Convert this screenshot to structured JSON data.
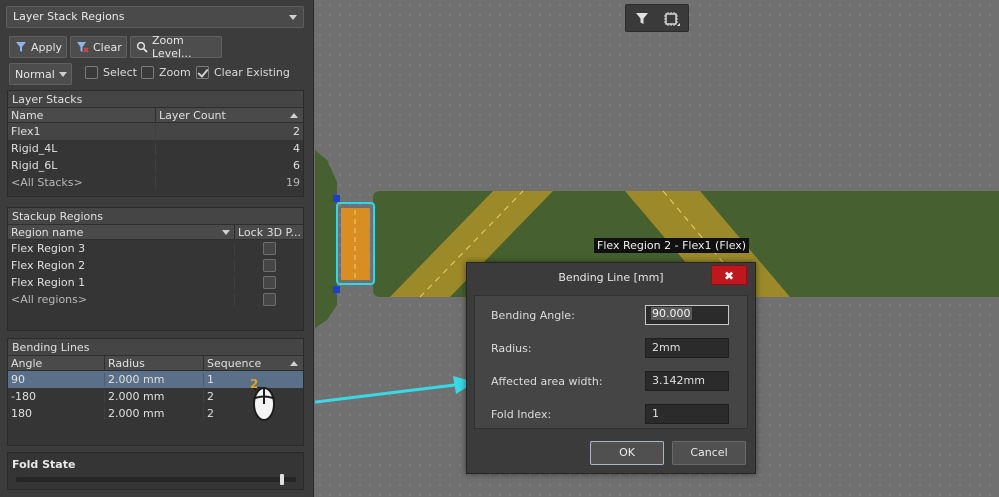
{
  "panel": {
    "mode_dropdown": "Layer Stack Regions",
    "buttons": {
      "apply": "Apply",
      "clear": "Clear",
      "zoom": "Zoom Level..."
    },
    "filter_mode": "Normal",
    "checks": [
      {
        "label": "Select",
        "checked": false
      },
      {
        "label": "Zoom",
        "checked": false
      },
      {
        "label": "Clear Existing",
        "checked": true
      }
    ]
  },
  "layer_stacks": {
    "title": "Layer Stacks",
    "columns": [
      "Name",
      "Layer Count"
    ],
    "rows": [
      {
        "name": "Flex1",
        "count": "2"
      },
      {
        "name": "Rigid_4L",
        "count": "4"
      },
      {
        "name": "Rigid_6L",
        "count": "6"
      },
      {
        "name": "<All Stacks>",
        "count": "19"
      }
    ]
  },
  "stackup_regions": {
    "title": "Stackup Regions",
    "columns": [
      "Region name",
      "Lock 3D P..."
    ],
    "rows": [
      {
        "name": "Flex Region 3"
      },
      {
        "name": "Flex Region 2"
      },
      {
        "name": "Flex Region 1"
      },
      {
        "name": "<All regions>"
      }
    ]
  },
  "bending_lines": {
    "title": "Bending Lines",
    "columns": [
      "Angle",
      "Radius",
      "Sequence"
    ],
    "rows": [
      {
        "angle": "90",
        "radius": "2.000 mm",
        "sequence": "1"
      },
      {
        "angle": "-180",
        "radius": "2.000 mm",
        "sequence": "2"
      },
      {
        "angle": "180",
        "radius": "2.000 mm",
        "sequence": "2"
      }
    ]
  },
  "fold_state": {
    "label": "Fold State",
    "value_fraction": 0.95
  },
  "canvas": {
    "tooltip": "Flex Region 2 - Flex1 (Flex)",
    "colors": {
      "board": "#46602f",
      "flex_band": "#a58e2a",
      "highlight": "#2fd8e8",
      "arrow": "#38d9e6"
    }
  },
  "dialog": {
    "title": "Bending Line [mm]",
    "close": "✖",
    "fields": [
      {
        "label": "Bending Angle:",
        "value": "90.000"
      },
      {
        "label": "Radius:",
        "value": "2mm"
      },
      {
        "label": "Affected area width:",
        "value": "3.142mm"
      },
      {
        "label": "Fold Index:",
        "value": "1"
      }
    ],
    "ok": "OK",
    "cancel": "Cancel"
  }
}
